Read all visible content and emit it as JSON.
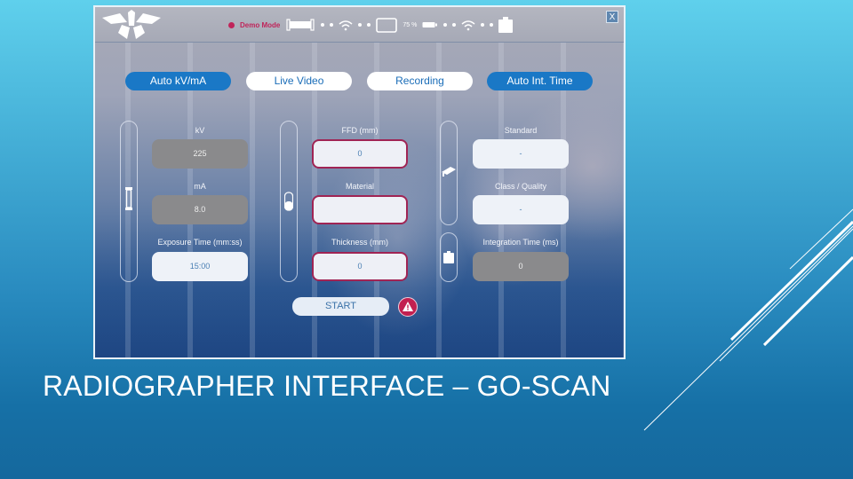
{
  "slide": {
    "title": "RADIOGRAPHER INTERFACE – GO-SCAN"
  },
  "app": {
    "status_bar": {
      "demo_mode_label": "Demo Mode",
      "battery_percent": "75 %",
      "icons": [
        "demo-dot-icon",
        "xray-tube-icon",
        "wifi-icon",
        "tablet-icon",
        "battery-icon",
        "wifi-icon",
        "detector-icon"
      ],
      "close_label": "X"
    },
    "mode_buttons": [
      {
        "label": "Auto kV/mA",
        "active": true
      },
      {
        "label": "Live Video",
        "active": false
      },
      {
        "label": "Recording",
        "active": false
      },
      {
        "label": "Auto Int. Time",
        "active": true
      }
    ],
    "left_panel": {
      "kv": {
        "label": "kV",
        "value": "225"
      },
      "ma": {
        "label": "mA",
        "value": "8.0"
      },
      "exposure_time": {
        "label": "Exposure Time (mm:ss)",
        "value": "15:00"
      }
    },
    "middle_panel": {
      "ffd": {
        "label": "FFD (mm)",
        "value": "0"
      },
      "material": {
        "label": "Material",
        "value": ""
      },
      "thickness": {
        "label": "Thickness (mm)",
        "value": "0"
      }
    },
    "right_panel": {
      "standard": {
        "label": "Standard",
        "value": "-"
      },
      "class_quality": {
        "label": "Class / Quality",
        "value": "-"
      },
      "integration_time": {
        "label": "Integration Time (ms)",
        "value": "0"
      }
    },
    "start_label": "START",
    "colors": {
      "accent_blue": "#1a78c6",
      "alert_red": "#c22050",
      "demo_red": "#c0245a"
    }
  }
}
